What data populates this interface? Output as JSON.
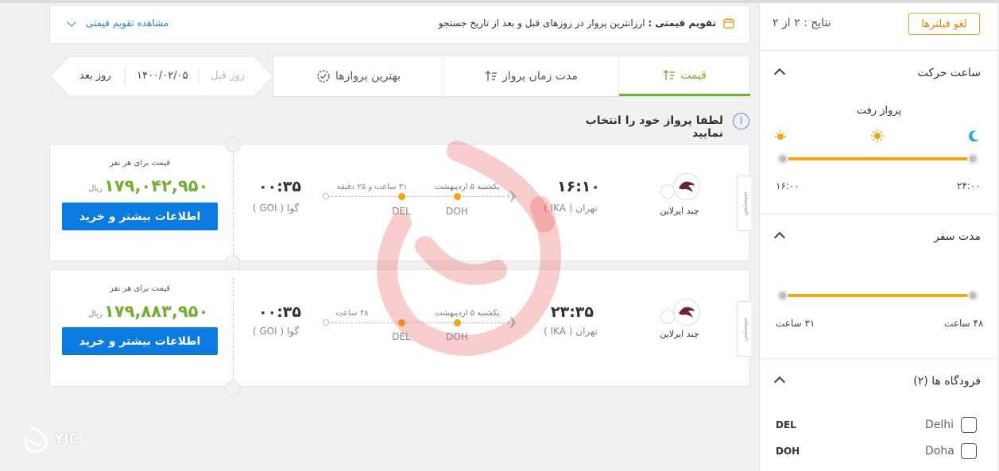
{
  "sidebar": {
    "clear_filters": "لغو فیلترها",
    "results": "نتایج : ۲ از ۲",
    "departure_time": {
      "title": "ساعت حرکت",
      "subtitle": "پرواز رفت",
      "min_label": "۱۶:۰۰",
      "max_label": "۲۴:۰۰"
    },
    "duration": {
      "title": "مدت سفر",
      "min_label": "۳۱ ساعت",
      "max_label": "۴۸ ساعت"
    },
    "airports": {
      "title": "فرودگاه ها (۲)",
      "items": [
        {
          "code": "DEL",
          "name": "Delhi"
        },
        {
          "code": "DOH",
          "name": "Doha"
        }
      ]
    }
  },
  "calendar_bar": {
    "title": "تقویم قیمتی :",
    "text": "ارزانترین پرواز در روزهای قبل و بعد از تاریخ جستجو",
    "link": "مشاهده تقویم قیمتی"
  },
  "date_nav": {
    "next_day": "روز بعد",
    "date": "۱۴۰۰/۰۲/۰۵",
    "prev_day": "روز قبل"
  },
  "sort_tabs": [
    {
      "label": "قیمت"
    },
    {
      "label": "مدت زمان پرواز"
    },
    {
      "label": "بهترین پروازها"
    }
  ],
  "instruction": "لطفا پرواز خود را انتخاب نمایید",
  "flights": [
    {
      "class_label": "سیستمی",
      "airline": "چند ایرلاین",
      "depart_time": "۱۶:۱۰",
      "depart_city": "تهران ( IKA )",
      "date_label": "یکشنبه ۵ اردیبهشت",
      "duration_label": "۳۱ ساعت و ۲۵ دقیقه",
      "stop1": "DOH",
      "stop2": "DEL",
      "arrive_time": "۰۰:۳۵",
      "arrive_city": "گوا ( GOI )",
      "price_caption": "قیمت برای هر نفر",
      "price": "۱۷۹,۰۴۲,۹۵۰",
      "currency": "ریال",
      "button": "اطلاعات بیشتر و خرید"
    },
    {
      "class_label": "سیستمی",
      "airline": "چند ایرلاین",
      "depart_time": "۲۳:۳۵",
      "depart_city": "تهران ( IKA )",
      "date_label": "یکشنبه ۵ اردیبهشت",
      "duration_label": "۴۸ ساعت",
      "stop1": "DOH",
      "stop2": "DEL",
      "arrive_time": "۰۰:۳۵",
      "arrive_city": "گوا ( GOI )",
      "price_caption": "قیمت برای هر نفر",
      "price": "۱۷۹,۸۸۳,۹۵۰",
      "currency": "ریال",
      "button": "اطلاعات بیشتر و خرید"
    }
  ],
  "watermark": "YJC",
  "colors": {
    "accent": "#74b032",
    "orange": "#f4a60a",
    "blue": "#0a7be0"
  }
}
